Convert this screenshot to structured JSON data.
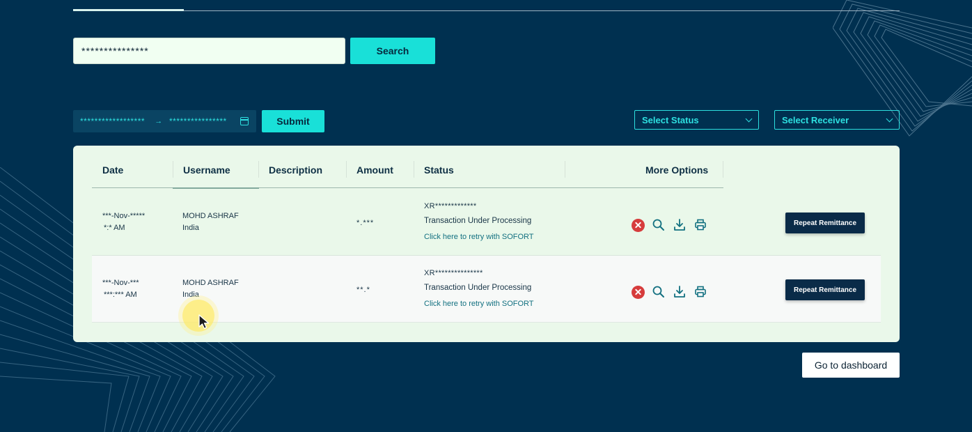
{
  "search": {
    "value": "***************",
    "button_label": "Search"
  },
  "filters": {
    "date_from": "******************",
    "date_arrow": "→",
    "date_to": "****************",
    "submit_label": "Submit",
    "status_placeholder": "Select Status",
    "receiver_placeholder": "Select Receiver"
  },
  "table": {
    "columns": [
      "Date",
      "Username",
      "Description",
      "Amount",
      "Status",
      "More Options"
    ],
    "rows": [
      {
        "date_line1": "***-Nov-*****",
        "date_line2": "*:* AM",
        "username": "MOHD ASHRAF",
        "country": "India",
        "description": "",
        "amount": "*.***",
        "reference": "XR*************",
        "status": "Transaction Under Processing",
        "retry_link": "Click here to retry with SOFORT",
        "repeat_label": "Repeat Remittance"
      },
      {
        "date_line1": "***-Nov-***",
        "date_line2": "***:*** AM",
        "username": "MOHD ASHRAF",
        "country": "India",
        "description": "",
        "amount": "**.*",
        "reference": "XR***************",
        "status": "Transaction Under Processing",
        "retry_link": "Click here to retry with SOFORT",
        "repeat_label": "Repeat Remittance"
      }
    ]
  },
  "footer": {
    "dashboard_label": "Go to dashboard"
  },
  "colors": {
    "background": "#003050",
    "accent": "#19e0d8",
    "table_bg": "#eaf8ea",
    "cancel_red": "#d63c3c",
    "button_dark": "#0a2b48"
  },
  "icons": [
    "cancel-icon",
    "search-icon",
    "download-icon",
    "print-icon",
    "calendar-icon",
    "chevron-down-icon",
    "cursor-icon"
  ]
}
